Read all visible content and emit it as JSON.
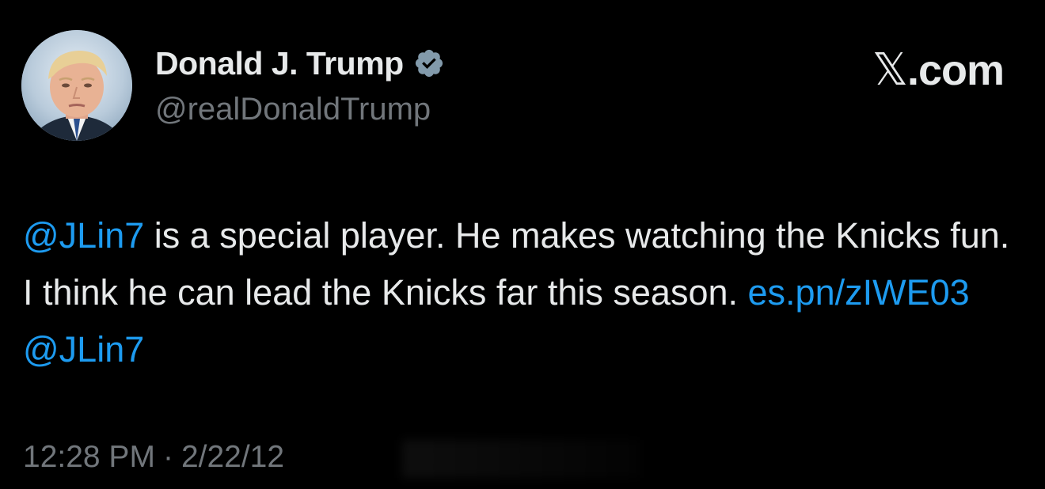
{
  "author": {
    "name": "Donald J. Trump",
    "handle": "@realDonaldTrump",
    "verified": true,
    "avatar_icon": "profile-photo"
  },
  "brand": {
    "x_glyph": "𝕏",
    "suffix": ".com"
  },
  "tweet": {
    "mention1": "@JLin7",
    "text1": " is a special player. He makes watching the Knicks fun. I think he can lead the Knicks far this season. ",
    "link": "es.pn/zIWE03",
    "space": " ",
    "mention2": "@JLin7"
  },
  "meta": {
    "time": "12:28 PM",
    "separator": "·",
    "date": "2/22/12"
  },
  "colors": {
    "background": "#000000",
    "text": "#e7e9ea",
    "secondary": "#71767b",
    "accent": "#1d9bf0",
    "verified": "#829aab"
  }
}
